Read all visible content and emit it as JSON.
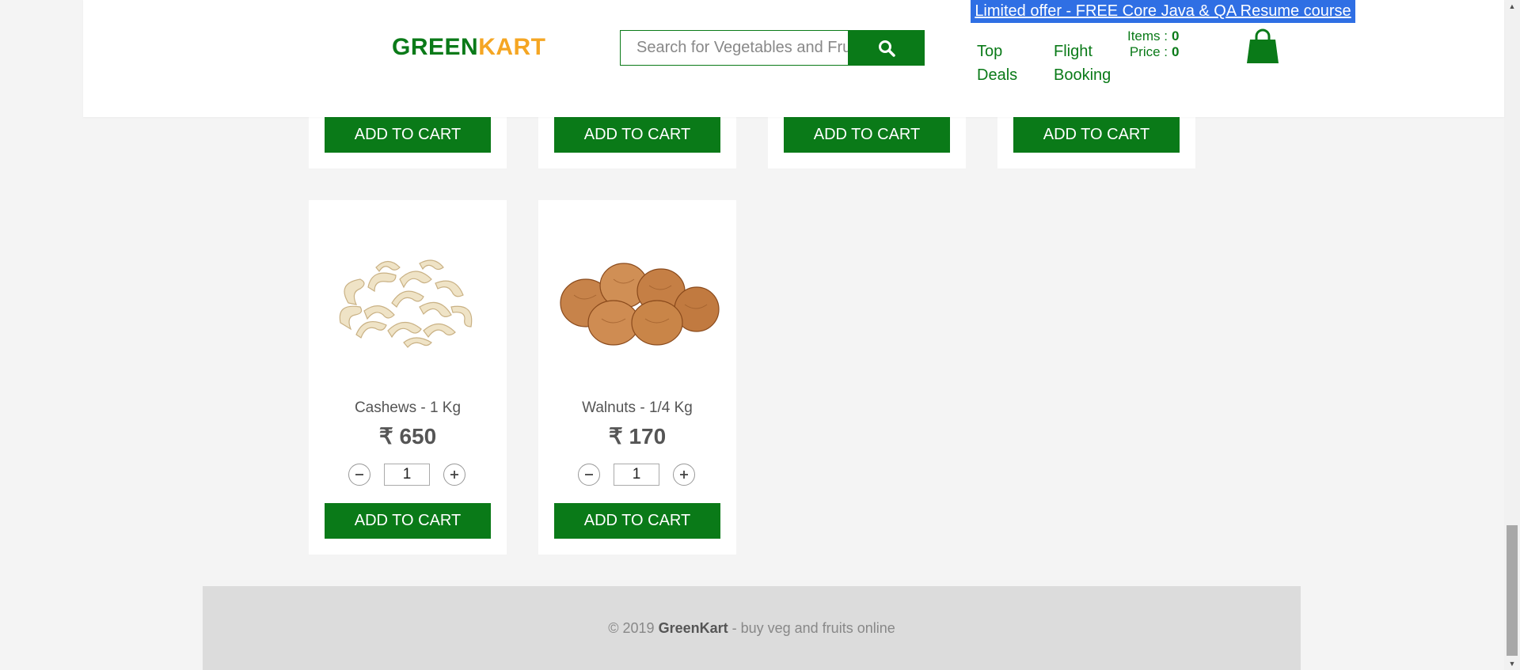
{
  "header": {
    "offer": "Limited offer - FREE Core Java & QA Resume course",
    "logo_green": "GREEN",
    "logo_kart": "KART",
    "search_placeholder": "Search for Vegetables and Fruits",
    "nav_top": "Top",
    "nav_deals": "Deals",
    "nav_flight": "Flight",
    "nav_booking": "Booking",
    "items_label": "Items  :",
    "items_value": "0",
    "price_label": "Price  :",
    "price_value": "0"
  },
  "top_row": {
    "add_label": "ADD TO CART"
  },
  "products": [
    {
      "name": "Cashews - 1 Kg",
      "price": "₹ 650",
      "qty": "1",
      "add_label": "ADD TO CART",
      "image": "cashews-image"
    },
    {
      "name": "Walnuts - 1/4 Kg",
      "price": "₹ 170",
      "qty": "1",
      "add_label": "ADD TO CART",
      "image": "walnuts-image"
    }
  ],
  "footer": {
    "prefix": "© 2019 ",
    "brand": "GreenKart",
    "suffix": " - buy veg and fruits online"
  },
  "colors": {
    "brand_green": "#0a7a18",
    "brand_orange": "#f5a623",
    "offer_blue": "#2f6fe4"
  }
}
